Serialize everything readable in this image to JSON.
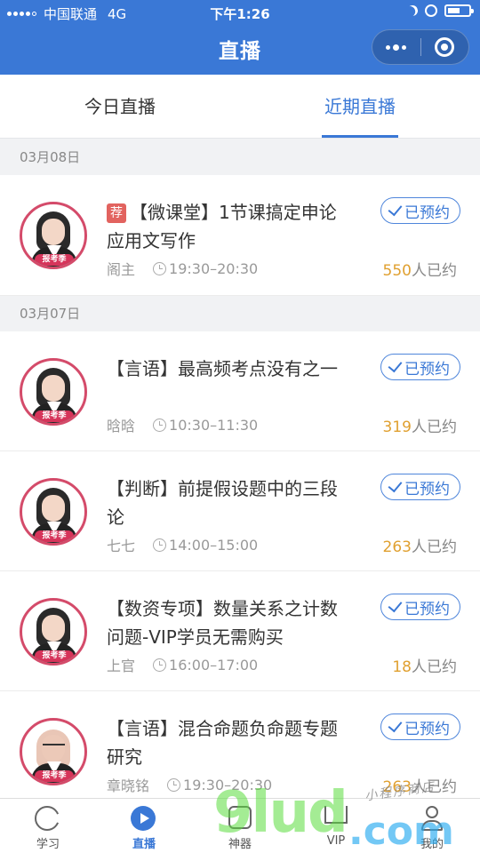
{
  "status_bar": {
    "carrier": "中国联通",
    "network": "4G",
    "time": "下午1:26"
  },
  "nav": {
    "title": "直播"
  },
  "tabs": [
    {
      "label": "今日直播",
      "active": false
    },
    {
      "label": "近期直播",
      "active": true
    }
  ],
  "sections": [
    {
      "date": "03月08日",
      "items": [
        {
          "recommend": "荐",
          "title": "【微课堂】1节课搞定申论应用文写作",
          "host": "阁主",
          "time": "19:30–20:30",
          "status": "已预约",
          "count": "550",
          "count_suffix": "人已约",
          "avatar_tag": "报考季"
        }
      ]
    },
    {
      "date": "03月07日",
      "items": [
        {
          "title": "【言语】最高频考点没有之一",
          "host": "晗晗",
          "time": "10:30–11:30",
          "status": "已预约",
          "count": "319",
          "count_suffix": "人已约",
          "avatar_tag": "报考季"
        },
        {
          "title": "【判断】前提假设题中的三段论",
          "host": "七七",
          "time": "14:00–15:00",
          "status": "已预约",
          "count": "263",
          "count_suffix": "人已约",
          "avatar_tag": "报考季"
        },
        {
          "title": "【数资专项】数量关系之计数问题-VIP学员无需购买",
          "host": "上官",
          "time": "16:00–17:00",
          "status": "已预约",
          "count": "18",
          "count_suffix": "人已约",
          "avatar_tag": "报考季"
        },
        {
          "title": "【言语】混合命题负命题专题研究",
          "host": "章晓铭",
          "time": "19:30–20:30",
          "status": "已预约",
          "count": "263",
          "count_suffix": "人已约",
          "avatar_tag": "报考季"
        }
      ]
    }
  ],
  "tabbar": [
    {
      "label": "学习",
      "icon": "pacman-icon"
    },
    {
      "label": "直播",
      "icon": "play-icon",
      "active": true
    },
    {
      "label": "神器",
      "icon": "tool-icon"
    },
    {
      "label": "VIP",
      "icon": "crown-icon"
    },
    {
      "label": "我的",
      "icon": "person-icon"
    }
  ],
  "watermark": {
    "text": "9lud",
    "dot_text": ".com",
    "small_text": "小程序商店"
  },
  "colors": {
    "primary": "#3a78d6",
    "count_highlight": "#e0a030",
    "recommend_badge": "#e2635f",
    "avatar_ring": "#d44b6a"
  }
}
